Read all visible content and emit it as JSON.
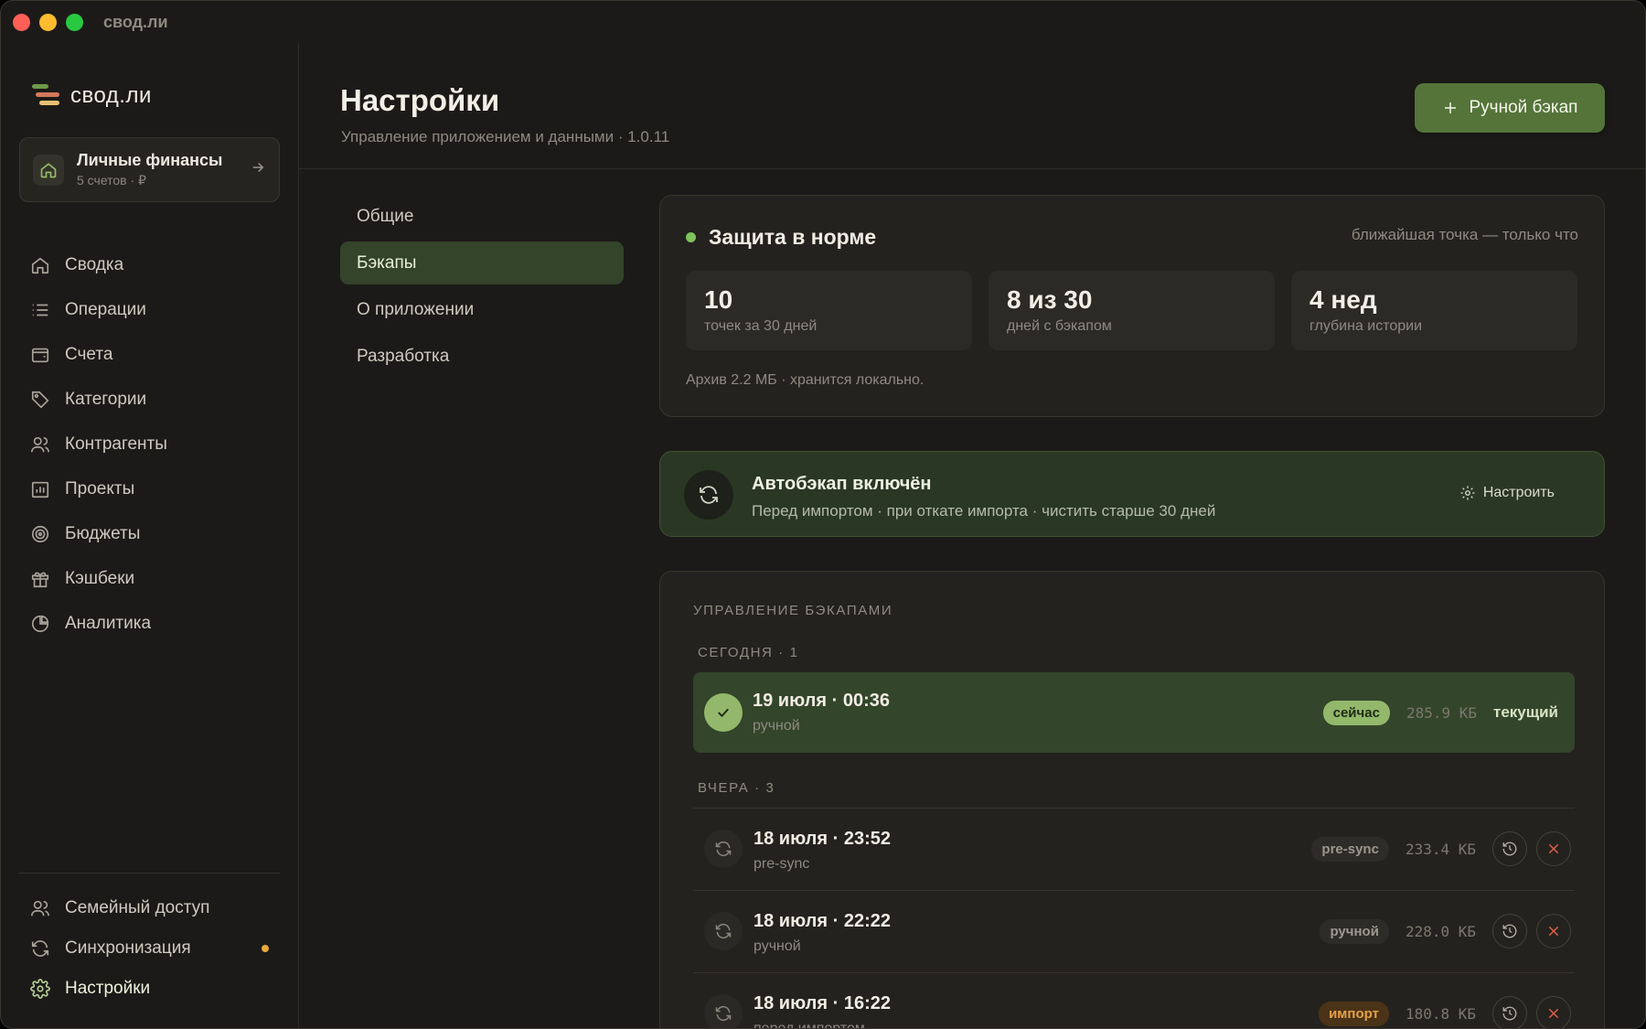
{
  "window": {
    "title": "свод.ли"
  },
  "sidebar": {
    "brand": "свод.ли",
    "workspace": {
      "name": "Личные финансы",
      "sub": "5 счетов · ₽"
    },
    "items": [
      {
        "label": "Сводка",
        "icon": "home-icon"
      },
      {
        "label": "Операции",
        "icon": "list-icon"
      },
      {
        "label": "Счета",
        "icon": "wallet-icon"
      },
      {
        "label": "Категории",
        "icon": "tag-icon"
      },
      {
        "label": "Контрагенты",
        "icon": "users-icon"
      },
      {
        "label": "Проекты",
        "icon": "chart-icon"
      },
      {
        "label": "Бюджеты",
        "icon": "target-icon"
      },
      {
        "label": "Кэшбеки",
        "icon": "gift-icon"
      },
      {
        "label": "Аналитика",
        "icon": "pie-icon"
      }
    ],
    "bottom": [
      {
        "label": "Семейный доступ",
        "icon": "users-icon"
      },
      {
        "label": "Синхронизация",
        "icon": "sync-icon"
      },
      {
        "label": "Настройки",
        "icon": "gear-icon"
      }
    ]
  },
  "header": {
    "title": "Настройки",
    "subtitle": "Управление приложением и данными · 1.0.11",
    "backup_button": "Ручной бэкап"
  },
  "subnav": [
    "Общие",
    "Бэкапы",
    "О приложении",
    "Разработка"
  ],
  "protection": {
    "title": "Защита в норме",
    "nearest": "ближайшая точка — только что",
    "stats": [
      {
        "value": "10",
        "label": "точек за 30 дней"
      },
      {
        "value": "8 из 30",
        "label": "дней с бэкапом"
      },
      {
        "value": "4 нед",
        "label": "глубина истории"
      }
    ],
    "archive": "Архив 2.2 МБ · хранится локально."
  },
  "autobackup": {
    "title": "Автобэкап включён",
    "sub": "Перед импортом · при откате импорта · чистить старше 30 дней",
    "configure": "Настроить"
  },
  "manage": {
    "title": "УПРАВЛЕНИЕ БЭКАПАМИ",
    "today": {
      "caption": "СЕГОДНЯ · 1",
      "item": {
        "title": "19 июля · 00:36",
        "sub": "ручной",
        "badge": "сейчас",
        "size": "285.9 КБ",
        "current": "текущий"
      }
    },
    "yesterday": {
      "caption": "ВЧЕРА · 3",
      "items": [
        {
          "title": "18 июля · 23:52",
          "sub": "pre-sync",
          "badge": "pre-sync",
          "size": "233.4 КБ"
        },
        {
          "title": "18 июля · 22:22",
          "sub": "ручной",
          "badge": "ручной",
          "size": "228.0 КБ"
        },
        {
          "title": "18 июля · 16:22",
          "sub": "перед импортом",
          "badge": "импорт",
          "size": "180.8 КБ"
        }
      ]
    }
  }
}
